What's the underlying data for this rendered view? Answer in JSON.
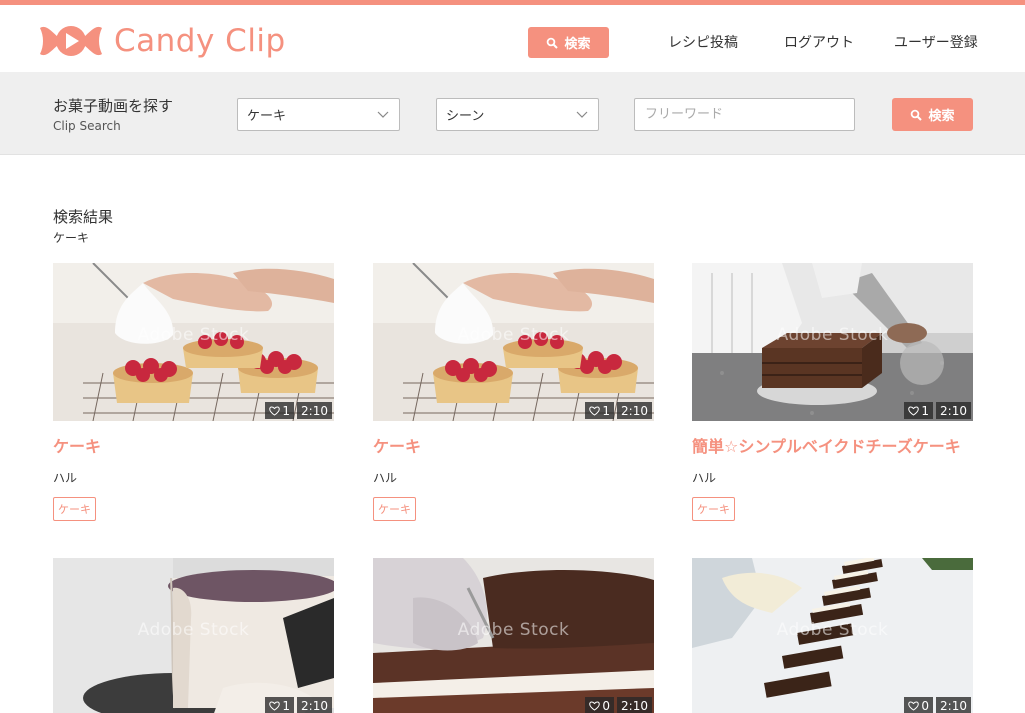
{
  "header": {
    "logo_text": "Candy Clip",
    "search_label": "検索",
    "nav": [
      {
        "label": "レシピ投稿"
      },
      {
        "label": "ログアウト"
      },
      {
        "label": "ユーザー登録"
      }
    ]
  },
  "search": {
    "title": "お菓子動画を探す",
    "subtitle": "Clip Search",
    "category_value": "ケーキ",
    "scene_value": "シーン",
    "freeword_placeholder": "フリーワード",
    "button_label": "検索"
  },
  "results": {
    "title": "検索結果",
    "query": "ケーキ"
  },
  "watermark": "Adobe Stock",
  "cards": [
    {
      "title": "ケーキ",
      "author": "ハル",
      "tag": "ケーキ",
      "likes": "1",
      "duration": "2:10",
      "scene": "tart"
    },
    {
      "title": "ケーキ",
      "author": "ハル",
      "tag": "ケーキ",
      "likes": "1",
      "duration": "2:10",
      "scene": "tart"
    },
    {
      "title": "簡単☆シンプルベイクドチーズケーキ",
      "author": "ハル",
      "tag": "ケーキ",
      "likes": "1",
      "duration": "2:10",
      "scene": "chocolate-cake"
    },
    {
      "title": "",
      "author": "",
      "tag": "",
      "likes": "1",
      "duration": "2:10",
      "scene": "cream-cake"
    },
    {
      "title": "",
      "author": "",
      "tag": "",
      "likes": "0",
      "duration": "2:10",
      "scene": "sponge-cut"
    },
    {
      "title": "",
      "author": "",
      "tag": "",
      "likes": "0",
      "duration": "2:10",
      "scene": "bars"
    }
  ],
  "colors": {
    "accent": "#f5917f",
    "searchbar_bg": "#efefef"
  },
  "icons": [
    "candy-logo-icon",
    "search-icon",
    "chevron-down-icon",
    "heart-icon"
  ]
}
